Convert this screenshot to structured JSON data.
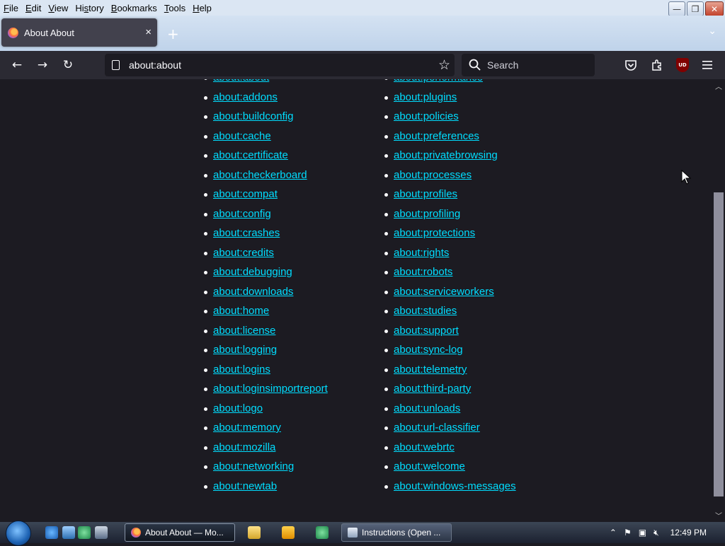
{
  "menu": [
    "File",
    "Edit",
    "View",
    "History",
    "Bookmarks",
    "Tools",
    "Help"
  ],
  "menu_underline": [
    "F",
    "E",
    "V",
    "s",
    "B",
    "T",
    "H"
  ],
  "tab": {
    "title": "About About",
    "close": "×"
  },
  "newtab": "+",
  "toolbar": {
    "back": "←",
    "forward": "→",
    "reload": "↻"
  },
  "url": "about:about",
  "search": {
    "placeholder": "Search"
  },
  "links_col1": [
    "about:about",
    "about:addons",
    "about:buildconfig",
    "about:cache",
    "about:certificate",
    "about:checkerboard",
    "about:compat",
    "about:config",
    "about:crashes",
    "about:credits",
    "about:debugging",
    "about:downloads",
    "about:home",
    "about:license",
    "about:logging",
    "about:logins",
    "about:loginsimportreport",
    "about:logo",
    "about:memory",
    "about:mozilla",
    "about:networking",
    "about:newtab"
  ],
  "links_col2": [
    "about:performance",
    "about:plugins",
    "about:policies",
    "about:preferences",
    "about:privatebrowsing",
    "about:processes",
    "about:profiles",
    "about:profiling",
    "about:protections",
    "about:rights",
    "about:robots",
    "about:serviceworkers",
    "about:studies",
    "about:support",
    "about:sync-log",
    "about:telemetry",
    "about:third-party",
    "about:unloads",
    "about:url-classifier",
    "about:webrtc",
    "about:welcome",
    "about:windows-messages"
  ],
  "taskbar": {
    "firefox_task": "About About — Mo...",
    "instructions_task": "Instructions (Open ...",
    "clock": "12:49 PM"
  },
  "colors": {
    "link": "#00ddff",
    "content_bg": "#1c1b22",
    "toolbar_bg": "#2b2a33"
  }
}
